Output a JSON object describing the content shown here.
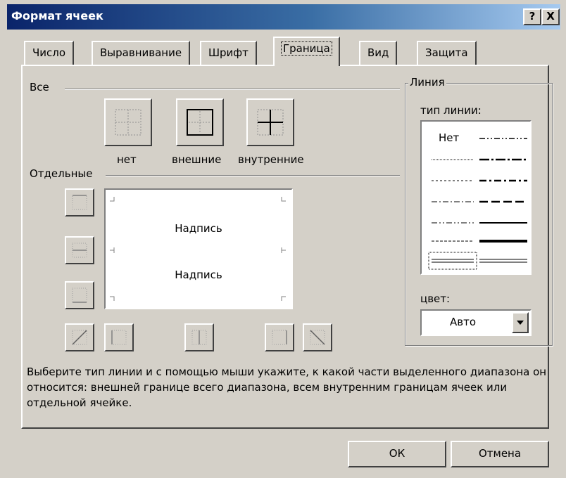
{
  "window": {
    "title": "Формат ячеек",
    "help_label": "?",
    "close_label": "X"
  },
  "tabs": [
    {
      "label": "Число"
    },
    {
      "label": "Выравнивание"
    },
    {
      "label": "Шрифт"
    },
    {
      "label": "Граница",
      "active": true
    },
    {
      "label": "Вид"
    },
    {
      "label": "Защита"
    }
  ],
  "presets": {
    "title": "Все",
    "none_label": "нет",
    "outline_label": "внешние",
    "inside_label": "внутренние"
  },
  "border": {
    "title": "Отдельные",
    "preview_text_1": "Надпись",
    "preview_text_2": "Надпись"
  },
  "line": {
    "title": "Линия",
    "style_label": "тип линии:",
    "none_text": "Нет",
    "color_label": "цвет:",
    "color_value": "Авто"
  },
  "help_text": "Выберите тип линии и с помощью мыши укажите, к какой части выделенного диапазона он относится: внешней границе всего диапазона, всем внутренним границам ячеек или отдельной ячейке.",
  "buttons": {
    "ok": "ОК",
    "cancel": "Отмена"
  },
  "colors": {
    "title_bar_start": "#0a246a",
    "title_bar_end": "#a6caf0",
    "face": "#d4d0c8"
  }
}
